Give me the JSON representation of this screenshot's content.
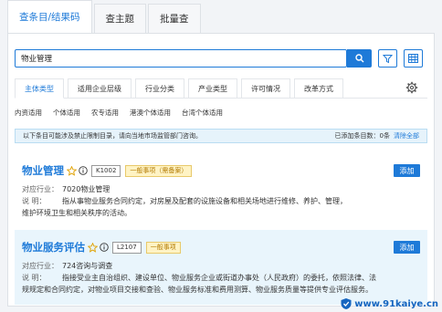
{
  "top_tabs": [
    {
      "label": "查条目/结果码",
      "active": true
    },
    {
      "label": "查主题",
      "active": false
    },
    {
      "label": "批量查",
      "active": false
    }
  ],
  "search": {
    "value": "物业管理"
  },
  "category_tabs": [
    {
      "label": "主体类型",
      "active": true
    },
    {
      "label": "适用企业层级",
      "active": false
    },
    {
      "label": "行业分类",
      "active": false
    },
    {
      "label": "产业类型",
      "active": false
    },
    {
      "label": "许可情况",
      "active": false
    },
    {
      "label": "改革方式",
      "active": false
    }
  ],
  "subtypes": [
    "内资适用",
    "个体适用",
    "农专适用",
    "港澳个体适用",
    "台湾个体适用"
  ],
  "notice": {
    "text": "以下条目可能涉及禁止限制目录，请向当地市场监管部门咨询。",
    "added_label": "已添加条目数：",
    "added_count": "0条",
    "clear": "清除全部"
  },
  "results": [
    {
      "title": "物业管理",
      "code": "K1002",
      "badge": "一般事项（需备案）",
      "add_label": "添加",
      "industry_label": "对应行业：",
      "industry": "7020物业管理",
      "desc_label": "说    明：",
      "desc_line1": "指从事物业服务合同约定，对房屋及配套的设施设备和相关场地进行维修、养护、管理，",
      "desc_line2": "维护环境卫生和相关秩序的活动。"
    },
    {
      "title": "物业服务评估",
      "code": "L2107",
      "badge": "一般事项",
      "add_label": "添加",
      "industry_label": "对应行业：",
      "industry": "724咨询与调查",
      "desc_label": "说    明：",
      "desc_line1": "指接受业主自治组织、建设单位、物业服务企业或街道办事处（人民政府）的委托，依照法律、法",
      "desc_line2": "规规定和合同约定，对物业项目交接和查验、物业服务标准和费用测算、物业服务质量等提供专业评估服务。"
    }
  ],
  "watermark": "www.91kaiye.cn",
  "colors": {
    "accent": "#1e7ad8",
    "badge_bg": "#fff3c4",
    "notice_bg": "#e6f3fb"
  }
}
